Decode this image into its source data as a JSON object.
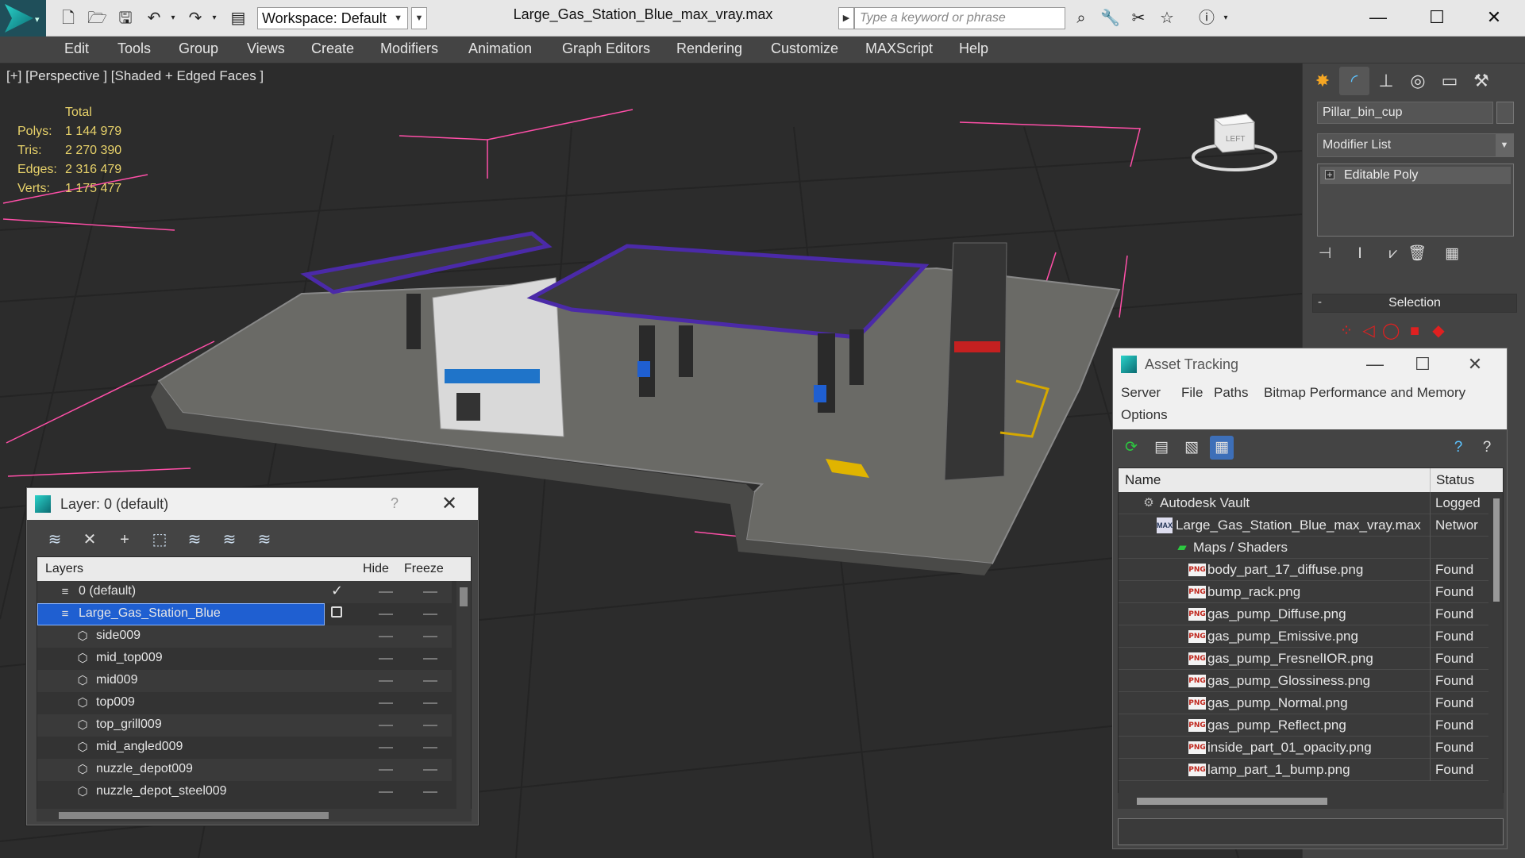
{
  "titlebar": {
    "workspace": "Workspace: Default",
    "document_title": "Large_Gas_Station_Blue_max_vray.max",
    "search_placeholder": "Type a keyword or phrase",
    "minimize": "—",
    "maximize": "☐",
    "close": "✕"
  },
  "menu": [
    "Edit",
    "Tools",
    "Group",
    "Views",
    "Create",
    "Modifiers",
    "Animation",
    "Graph Editors",
    "Rendering",
    "Customize",
    "MAXScript",
    "Help"
  ],
  "viewport": {
    "label": "[+] [Perspective ] [Shaded + Edged Faces ]",
    "stats_header": "Total",
    "stats": [
      {
        "key": "Polys:",
        "value": "1 144 979"
      },
      {
        "key": "Tris:",
        "value": "2 270 390"
      },
      {
        "key": "Edges:",
        "value": "2 316 479"
      },
      {
        "key": "Verts:",
        "value": "1 175 477"
      }
    ],
    "viewcube_label": "LEFT"
  },
  "command_panel": {
    "object_name": "Pillar_bin_cup",
    "modifier_list": "Modifier List",
    "stack_item": "Editable Poly",
    "rollout_title": "Selection",
    "rollout_toggle": "-"
  },
  "layer_dialog": {
    "title": "Layer: 0 (default)",
    "help": "?",
    "close": "✕",
    "columns": {
      "layers": "Layers",
      "hide": "Hide",
      "freeze": "Freeze"
    },
    "rows": [
      {
        "name": "0 (default)",
        "level": 0,
        "type": "layer",
        "current": true
      },
      {
        "name": "Large_Gas_Station_Blue",
        "level": 0,
        "type": "layer",
        "selected": true
      },
      {
        "name": "side009",
        "level": 1,
        "type": "object"
      },
      {
        "name": "mid_top009",
        "level": 1,
        "type": "object"
      },
      {
        "name": "mid009",
        "level": 1,
        "type": "object"
      },
      {
        "name": "top009",
        "level": 1,
        "type": "object"
      },
      {
        "name": "top_grill009",
        "level": 1,
        "type": "object"
      },
      {
        "name": "mid_angled009",
        "level": 1,
        "type": "object"
      },
      {
        "name": "nuzzle_depot009",
        "level": 1,
        "type": "object"
      },
      {
        "name": "nuzzle_depot_steel009",
        "level": 1,
        "type": "object"
      }
    ]
  },
  "asset_dialog": {
    "title": "Asset Tracking",
    "menu": [
      "Server",
      "File",
      "Paths",
      "Bitmap Performance and Memory",
      "Options"
    ],
    "columns": {
      "name": "Name",
      "status": "Status"
    },
    "rows": [
      {
        "name": "Autodesk Vault",
        "status": "Logged",
        "type": "vault",
        "level": 1
      },
      {
        "name": "Large_Gas_Station_Blue_max_vray.max",
        "status": "Networ",
        "type": "max",
        "level": 2
      },
      {
        "name": "Maps / Shaders",
        "status": "",
        "type": "maps",
        "level": 3
      },
      {
        "name": "body_part_17_diffuse.png",
        "status": "Found",
        "type": "png",
        "level": 4
      },
      {
        "name": "bump_rack.png",
        "status": "Found",
        "type": "png",
        "level": 4
      },
      {
        "name": "gas_pump_Diffuse.png",
        "status": "Found",
        "type": "png",
        "level": 4
      },
      {
        "name": "gas_pump_Emissive.png",
        "status": "Found",
        "type": "png",
        "level": 4
      },
      {
        "name": "gas_pump_FresnelIOR.png",
        "status": "Found",
        "type": "png",
        "level": 4
      },
      {
        "name": "gas_pump_Glossiness.png",
        "status": "Found",
        "type": "png",
        "level": 4
      },
      {
        "name": "gas_pump_Normal.png",
        "status": "Found",
        "type": "png",
        "level": 4
      },
      {
        "name": "gas_pump_Reflect.png",
        "status": "Found",
        "type": "png",
        "level": 4
      },
      {
        "name": "inside_part_01_opacity.png",
        "status": "Found",
        "type": "png",
        "level": 4
      },
      {
        "name": "lamp_part_1_bump.png",
        "status": "Found",
        "type": "png",
        "level": 4
      }
    ],
    "png_label": "PNG",
    "max_label": "MAX"
  },
  "colors": {
    "accent": "#2ad2c9",
    "selection_blue": "#1f5fd1",
    "stats_yellow": "#e8d26a",
    "canopy_purple": "#4b2aa8",
    "wire_pink": "#ff4fa8"
  }
}
